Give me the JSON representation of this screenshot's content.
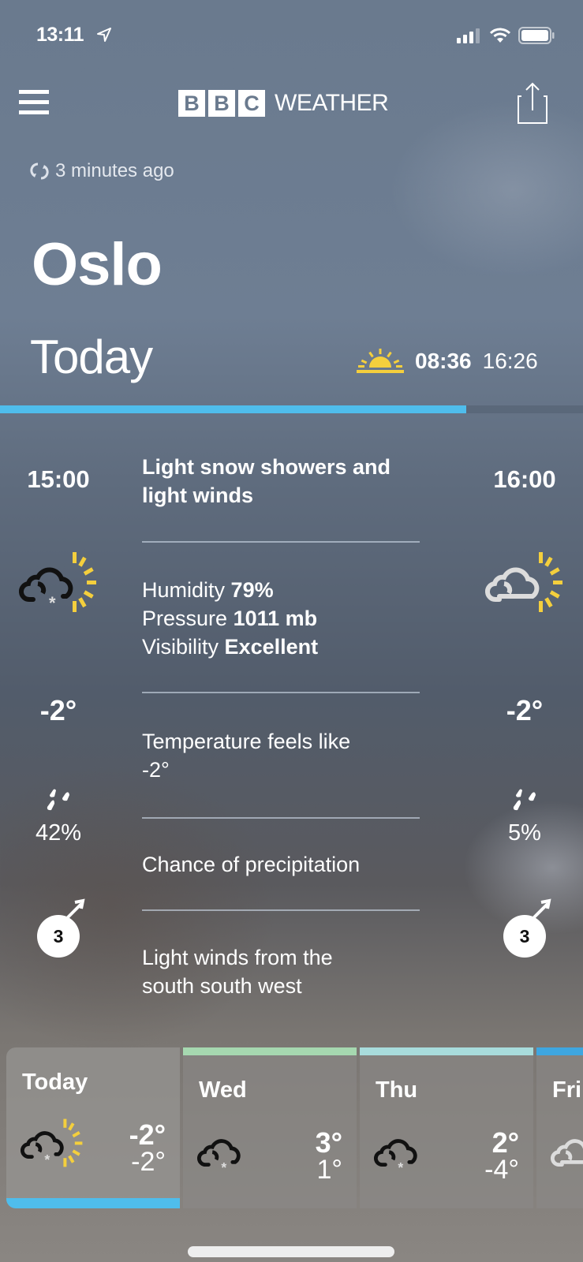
{
  "status_bar": {
    "time": "13:11",
    "location_icon": "location-arrow-icon",
    "signal_icon": "cellular-signal-icon",
    "wifi_icon": "wifi-icon",
    "battery_icon": "battery-icon"
  },
  "header": {
    "menu_icon": "hamburger-menu-icon",
    "logo_letters": [
      "B",
      "B",
      "C"
    ],
    "logo_word": "WEATHER",
    "share_icon": "share-icon"
  },
  "updated": {
    "icon": "refresh-icon",
    "text": "3 minutes ago"
  },
  "location": {
    "city": "Oslo",
    "day_label": "Today"
  },
  "sun": {
    "icon": "sunrise-icon",
    "sunrise": "08:36",
    "sunset": "16:26"
  },
  "day_progress": {
    "fraction": 0.8,
    "color": "#4fbdec"
  },
  "hours": [
    {
      "time": "15:00",
      "icon": "sunny-intervals-light-snow-icon",
      "temp": "-2°",
      "precip_icon": "raindrops-icon",
      "precip": "42%",
      "wind_speed": "3",
      "wind_icon": "wind-direction-icon"
    },
    {
      "time": "16:00",
      "icon": "sunny-intervals-cloud-icon",
      "temp": "-2°",
      "precip_icon": "raindrops-icon",
      "precip": "5%",
      "wind_speed": "3",
      "wind_icon": "wind-direction-icon"
    }
  ],
  "detail": {
    "summary": "Light snow showers and light winds",
    "humidity_label": "Humidity",
    "humidity_value": "79%",
    "pressure_label": "Pressure",
    "pressure_value": "1011 mb",
    "visibility_label": "Visibility",
    "visibility_value": "Excellent",
    "feels_like_label": "Temperature feels like",
    "feels_like_value": "-2°",
    "precip_label": "Chance of precipitation",
    "wind_text": "Light winds from the south south west"
  },
  "days": [
    {
      "name": "Today",
      "icon": "sunny-intervals-light-snow-icon",
      "high": "-2°",
      "low": "-2°",
      "accent": "#4fbdec",
      "selected": true
    },
    {
      "name": "Wed",
      "icon": "light-snow-icon",
      "high": "3°",
      "low": "1°",
      "accent": "#a6d8b0",
      "selected": false
    },
    {
      "name": "Thu",
      "icon": "light-snow-icon",
      "high": "2°",
      "low": "-4°",
      "accent": "#a8dcdc",
      "selected": false
    },
    {
      "name": "Fri",
      "icon": "cloud-icon",
      "high": "",
      "low": "",
      "accent": "#3ea6e0",
      "selected": false
    }
  ]
}
